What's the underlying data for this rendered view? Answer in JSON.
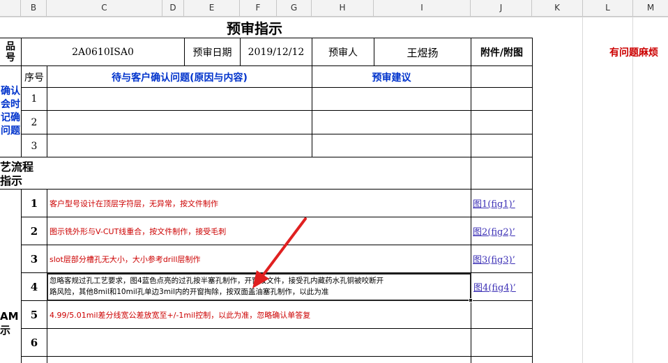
{
  "colors": {
    "blue_text": "#0033cc",
    "red_text": "#cc0000",
    "link": "#3b2fb5",
    "arrow": "#e02020"
  },
  "column_headers": [
    "B",
    "C",
    "D",
    "E",
    "F",
    "G",
    "H",
    "I",
    "J",
    "K",
    "L",
    "M"
  ],
  "header": {
    "title": "预审指示",
    "product_label": "品\n号",
    "product_no": "2A0610ISA0",
    "date_label": "预审日期",
    "date_value": "2019/12/12",
    "reviewer_label": "预审人",
    "reviewer_name": "王煜扬",
    "attachment_label": "附件/附图",
    "notice": "有问题麻烦"
  },
  "confirm_section": {
    "side_label": "确认\n会时\n记确\n问题",
    "col_seq": "序号",
    "col_issue": "待与客户确认问题(原因与内容)",
    "col_advice": "预审建议",
    "rows": [
      "1",
      "2",
      "3"
    ]
  },
  "process_section": {
    "side_label": "艺流程\n指示",
    "bottom_label": "AM\n示",
    "rows": [
      {
        "num": "1",
        "text": "客户型号设计在顶层字符层，无异常，按文件制作",
        "link": "图1(fig1)’"
      },
      {
        "num": "2",
        "text": "图示铣外形与V-CUT线重合，按文件制作，接受毛刺",
        "link": "图2(fig2)’"
      },
      {
        "num": "3",
        "text": "slot层部分槽孔无大小，大小参考drill层制作",
        "link": "图3(fig3)’"
      },
      {
        "num": "4",
        "text_line1": "忽略客规过孔工艺要求，图4蓝色点亮的过孔按半塞孔制作，开窗按文件，接受孔内藏药水孔铜被咬断开",
        "text_line2": "路风险，其他8mil和10mil孔单边3mil内的开窗掏除，按双面盖油塞孔制作，以此为准",
        "link": "图4(fig4)’"
      },
      {
        "num": "5",
        "text": "4.99/5.01mil差分线宽公差放宽至+/-1mil控制，以此为准，忽略确认单答复",
        "link": ""
      },
      {
        "num": "6",
        "text": "",
        "link": ""
      }
    ]
  }
}
